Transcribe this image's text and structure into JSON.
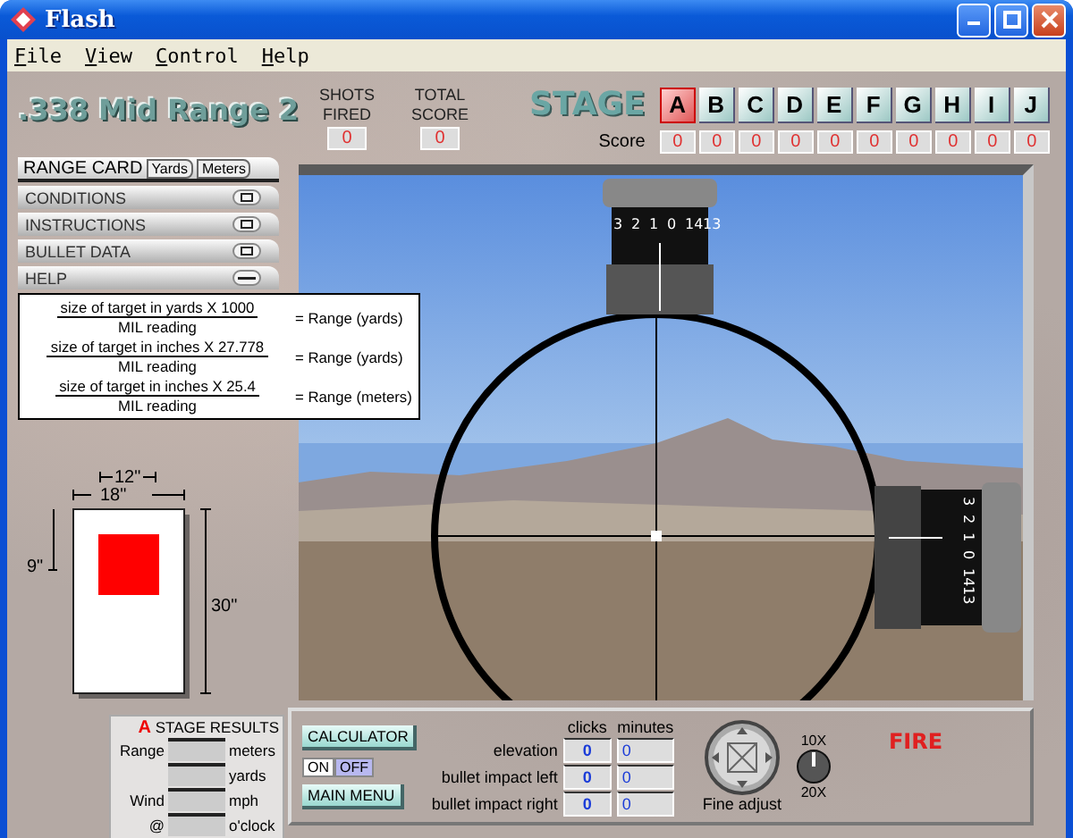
{
  "window": {
    "title": "Flash"
  },
  "menu": [
    "File",
    "View",
    "Control",
    "Help"
  ],
  "header": {
    "title": ".338 Mid Range 2",
    "counters": [
      {
        "label": "SHOTS FIRED",
        "value": "0"
      },
      {
        "label": "TOTAL SCORE",
        "value": "0"
      }
    ],
    "stage_label": "STAGE",
    "score_label": "Score",
    "stages": [
      {
        "letter": "A",
        "selected": true,
        "score": "0"
      },
      {
        "letter": "B",
        "selected": false,
        "score": "0"
      },
      {
        "letter": "C",
        "selected": false,
        "score": "0"
      },
      {
        "letter": "D",
        "selected": false,
        "score": "0"
      },
      {
        "letter": "E",
        "selected": false,
        "score": "0"
      },
      {
        "letter": "F",
        "selected": false,
        "score": "0"
      },
      {
        "letter": "G",
        "selected": false,
        "score": "0"
      },
      {
        "letter": "H",
        "selected": false,
        "score": "0"
      },
      {
        "letter": "I",
        "selected": false,
        "score": "0"
      },
      {
        "letter": "J",
        "selected": false,
        "score": "0"
      }
    ]
  },
  "left_panel": {
    "range_card": {
      "label": "RANGE CARD",
      "units": [
        "Yards",
        "Meters"
      ]
    },
    "sections": [
      {
        "label": "CONDITIONS",
        "expanded": false
      },
      {
        "label": "INSTRUCTIONS",
        "expanded": false
      },
      {
        "label": "BULLET DATA",
        "expanded": false
      },
      {
        "label": "HELP",
        "expanded": true
      }
    ],
    "help_formulas": [
      {
        "numerator": "size of target in yards X 1000",
        "denominator": "MIL reading",
        "result": "= Range (yards)"
      },
      {
        "numerator": "size of target in inches X 27.778",
        "denominator": "MIL reading",
        "result": "= Range (yards)"
      },
      {
        "numerator": "size of target in inches X 25.4",
        "denominator": "MIL reading",
        "result": "= Range (meters)"
      }
    ],
    "target": {
      "inner_width": "12\"",
      "outer_width": "18\"",
      "offset": "9\"",
      "height": "30\""
    },
    "stage_results": {
      "stage": "A",
      "title": "STAGE RESULTS",
      "rows": [
        {
          "label": "Range",
          "unit": "meters"
        },
        {
          "unit": "yards"
        },
        {
          "label": "Wind",
          "unit": "mph"
        },
        {
          "label": "@",
          "unit": "o'clock"
        }
      ]
    }
  },
  "scope": {
    "top_scale": [
      "3",
      "2",
      "1",
      "0",
      "14",
      "13"
    ],
    "right_scale": [
      "3",
      "2",
      "1",
      "0",
      "14",
      "13"
    ]
  },
  "controls": {
    "calculator": "CALCULATOR",
    "toggle": [
      {
        "label": "ON",
        "selected": false
      },
      {
        "label": "OFF",
        "selected": true
      }
    ],
    "main_menu": "MAIN MENU",
    "columns": [
      "clicks",
      "minutes"
    ],
    "rows": [
      {
        "label": "elevation",
        "clicks": "0",
        "minutes": "0"
      },
      {
        "label": "bullet impact left",
        "clicks": "0",
        "minutes": "0"
      },
      {
        "label": "bullet impact right",
        "clicks": "0",
        "minutes": "0"
      }
    ],
    "fine_adjust": "Fine adjust",
    "zoom_low": "10X",
    "zoom_high": "20X",
    "fire": "FIRE"
  }
}
